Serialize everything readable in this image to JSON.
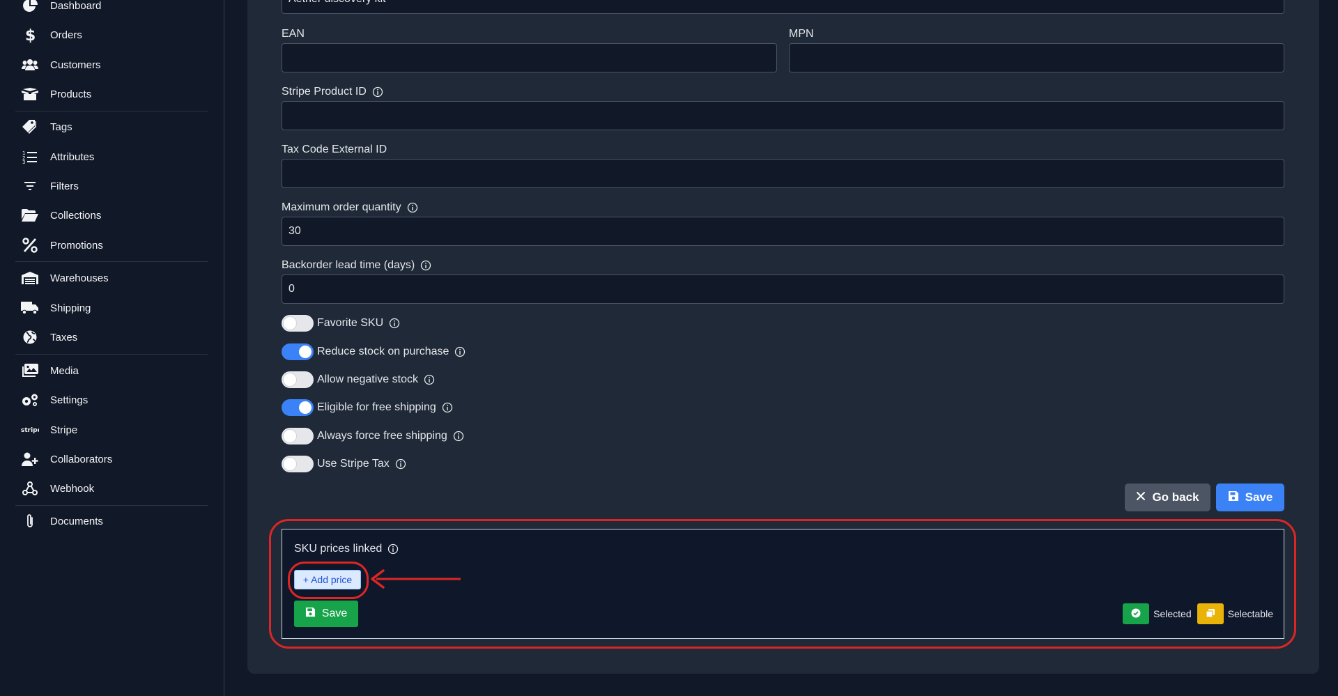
{
  "sidebar": {
    "items": [
      {
        "label": "Dashboard",
        "icon": "pie-chart-icon"
      },
      {
        "label": "Orders",
        "icon": "dollar-icon"
      },
      {
        "label": "Customers",
        "icon": "users-icon"
      },
      {
        "label": "Products",
        "icon": "box-icon"
      },
      {
        "label": "Tags",
        "icon": "tags-icon"
      },
      {
        "label": "Attributes",
        "icon": "list-ordered-icon"
      },
      {
        "label": "Filters",
        "icon": "filter-lines-icon"
      },
      {
        "label": "Collections",
        "icon": "folder-open-icon"
      },
      {
        "label": "Promotions",
        "icon": "percent-icon"
      },
      {
        "label": "Warehouses",
        "icon": "warehouse-icon"
      },
      {
        "label": "Shipping",
        "icon": "truck-icon"
      },
      {
        "label": "Taxes",
        "icon": "globe-icon"
      },
      {
        "label": "Media",
        "icon": "images-icon"
      },
      {
        "label": "Settings",
        "icon": "gears-icon"
      },
      {
        "label": "Stripe",
        "icon": "stripe-logo-icon",
        "icon_text": "stripe"
      },
      {
        "label": "Collaborators",
        "icon": "user-plus-icon"
      },
      {
        "label": "Webhook",
        "icon": "webhook-icon"
      },
      {
        "label": "Documents",
        "icon": "paperclip-icon"
      }
    ]
  },
  "form": {
    "name_value": "Aether discovery kit",
    "ean": {
      "label": "EAN",
      "value": ""
    },
    "mpn": {
      "label": "MPN",
      "value": ""
    },
    "stripe_product_id": {
      "label": "Stripe Product ID",
      "value": ""
    },
    "tax_code": {
      "label": "Tax Code External ID",
      "value": ""
    },
    "max_order_qty": {
      "label": "Maximum order quantity",
      "value": "30"
    },
    "backorder_lead": {
      "label": "Backorder lead time (days)",
      "value": "0"
    },
    "toggles": [
      {
        "label": "Favorite SKU",
        "on": false
      },
      {
        "label": "Reduce stock on purchase",
        "on": true
      },
      {
        "label": "Allow negative stock",
        "on": false
      },
      {
        "label": "Eligible for free shipping",
        "on": true
      },
      {
        "label": "Always force free shipping",
        "on": false
      },
      {
        "label": "Use Stripe Tax",
        "on": false
      }
    ]
  },
  "actions": {
    "go_back_label": "Go back",
    "save_label": "Save"
  },
  "sku_prices": {
    "title": "SKU prices linked",
    "add_price_label": "+ Add price",
    "save_label": "Save",
    "legend": {
      "selected": "Selected",
      "selectable": "Selectable"
    }
  },
  "colors": {
    "background": "#111827",
    "card": "#1f2937",
    "accent_blue": "#3b82f6",
    "success_green": "#16a34a",
    "warning_yellow": "#eab308",
    "annotation_red": "#dc2626"
  }
}
